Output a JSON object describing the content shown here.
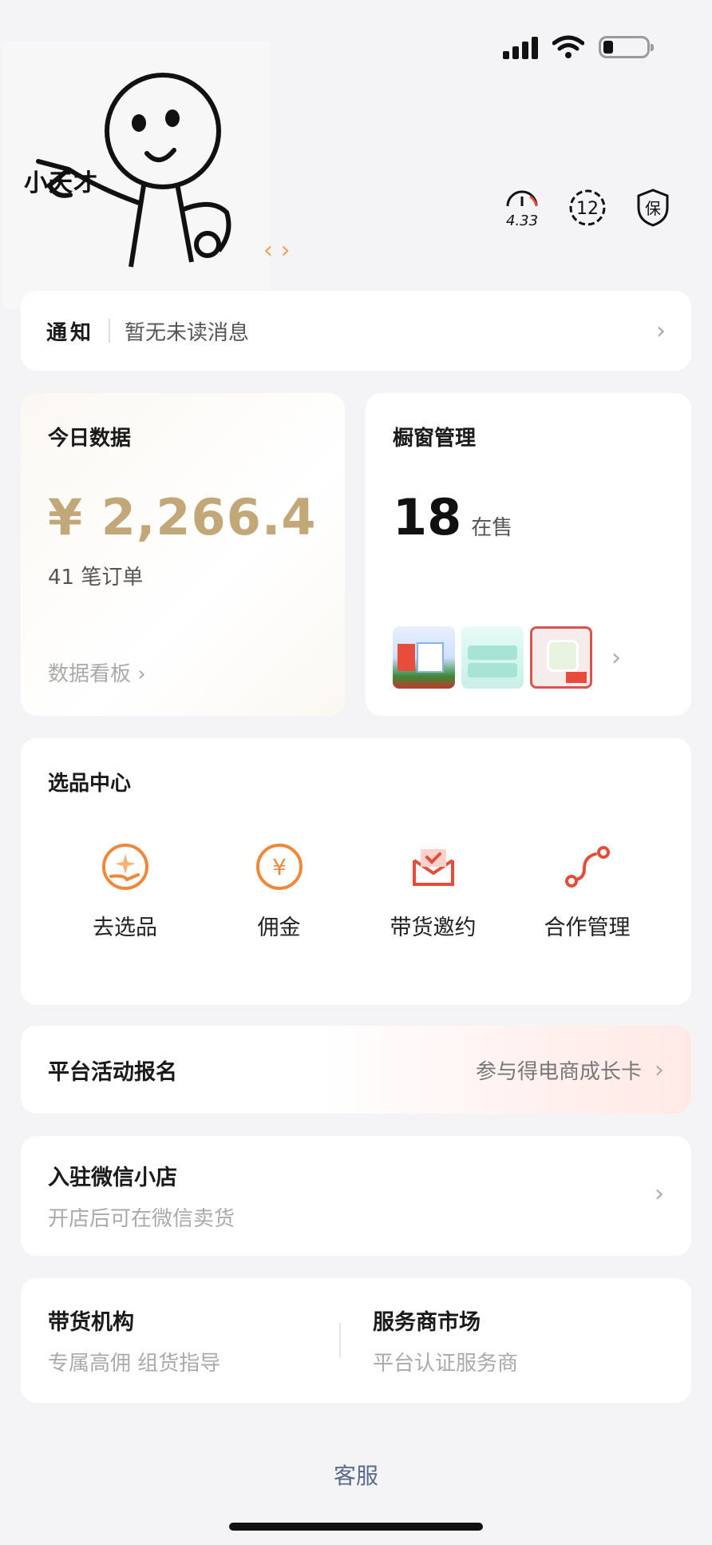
{
  "sticker": {
    "caption": "小天才"
  },
  "header": {
    "score_badge": "4.33",
    "level_badge": "12",
    "guarantee_badge": "保"
  },
  "notice": {
    "title": "通知",
    "text": "暂无未读消息"
  },
  "today": {
    "title": "今日数据",
    "amount": "¥ 2,266.4",
    "orders": "41 笔订单",
    "link": "数据看板"
  },
  "window": {
    "title": "橱窗管理",
    "count": "18",
    "unit": "在售"
  },
  "selection_center": {
    "title": "选品中心",
    "tools": [
      {
        "label": "去选品",
        "icon": "hand-star-icon"
      },
      {
        "label": "佣金",
        "icon": "yen-coin-icon"
      },
      {
        "label": "带货邀约",
        "icon": "envelope-icon"
      },
      {
        "label": "合作管理",
        "icon": "path-nodes-icon"
      }
    ]
  },
  "activity": {
    "title": "平台活动报名",
    "sub": "参与得电商成长卡"
  },
  "wxshop": {
    "title": "入驻微信小店",
    "sub": "开店后可在微信卖货"
  },
  "agency": {
    "title": "带货机构",
    "sub": "专属高佣 组货指导"
  },
  "market": {
    "title": "服务商市场",
    "sub": "平台认证服务商"
  },
  "footer": {
    "service": "客服"
  },
  "colors": {
    "accent_gold": "#c2a878",
    "tool_orange": "#f0883a",
    "link_blue": "#5a6a8a"
  }
}
